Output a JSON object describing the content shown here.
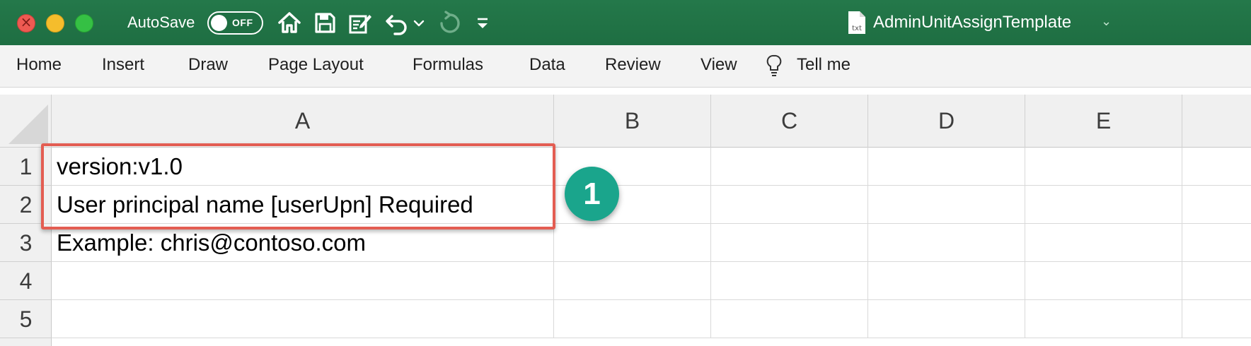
{
  "titlebar": {
    "autosave_label": "AutoSave",
    "autosave_state": "OFF",
    "icons": [
      "home-icon",
      "save-icon",
      "edit-doc-icon",
      "undo-icon",
      "undo-dropdown-icon",
      "redo-icon",
      "customize-toolbar-icon"
    ],
    "doc_icon_label": "txt",
    "document_title": "AdminUnitAssignTemplate",
    "bg_color": "#217346"
  },
  "ribbon": {
    "tabs": [
      "Home",
      "Insert",
      "Draw",
      "Page Layout",
      "Formulas",
      "Data",
      "Review",
      "View"
    ],
    "tell_me": "Tell me"
  },
  "sheet": {
    "columns": [
      "A",
      "B",
      "C",
      "D",
      "E"
    ],
    "rows": [
      "1",
      "2",
      "3",
      "4",
      "5"
    ],
    "cells": {
      "A1": "version:v1.0",
      "A2": "User principal name [userUpn] Required",
      "A3": "Example: chris@contoso.com"
    }
  },
  "annotation": {
    "callout_number": "1",
    "highlight_color": "#e35d52",
    "callout_color": "#1aa58c"
  }
}
